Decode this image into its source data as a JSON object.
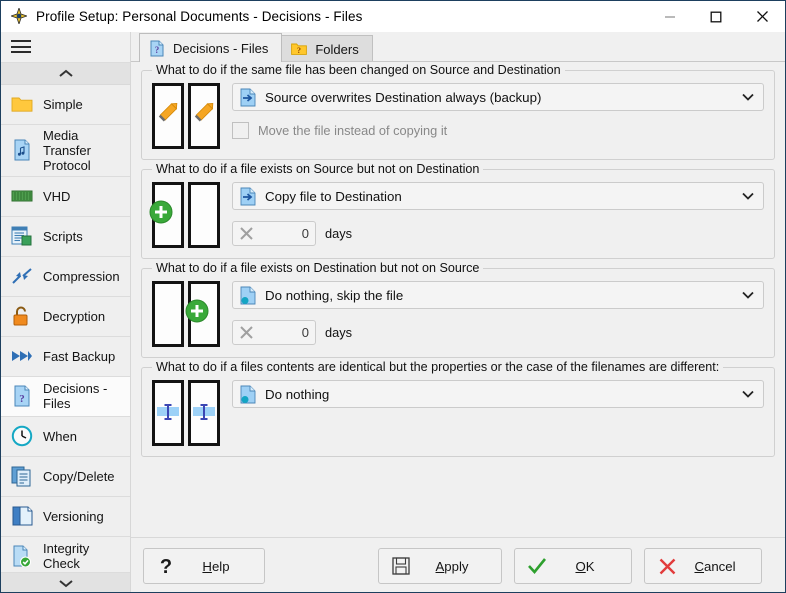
{
  "window": {
    "title": "Profile Setup: Personal Documents - Decisions - Files",
    "app_icon": "compass-icon",
    "minimize_label": "Minimize",
    "maximize_label": "Maximize",
    "close_label": "Close"
  },
  "sidebar": {
    "menu_label": "Menu",
    "scroll_up_label": "Scroll up",
    "scroll_down_label": "Scroll down",
    "items": [
      {
        "label": "Simple",
        "icon": "folder-icon",
        "selected": false
      },
      {
        "label": "Media Transfer\nProtocol",
        "icon": "music-file-icon",
        "selected": false
      },
      {
        "label": "VHD",
        "icon": "drive-icon",
        "selected": false
      },
      {
        "label": "Scripts",
        "icon": "script-icon",
        "selected": false
      },
      {
        "label": "Compression",
        "icon": "compress-arrows-icon",
        "selected": false
      },
      {
        "label": "Decryption",
        "icon": "open-lock-icon",
        "selected": false
      },
      {
        "label": "Fast Backup",
        "icon": "fast-forward-icon",
        "selected": false
      },
      {
        "label": "Decisions -\nFiles",
        "icon": "question-file-icon",
        "selected": true
      },
      {
        "label": "When",
        "icon": "clock-icon",
        "selected": false
      },
      {
        "label": "Copy/Delete",
        "icon": "copy-icon",
        "selected": false
      },
      {
        "label": "Versioning",
        "icon": "versioning-icon",
        "selected": false
      },
      {
        "label": "Integrity Check",
        "icon": "check-file-icon",
        "selected": false
      }
    ]
  },
  "tabs": [
    {
      "label": "Decisions - Files",
      "icon": "question-file-icon",
      "active": true
    },
    {
      "label": "Folders",
      "icon": "question-folder-icon",
      "active": false
    }
  ],
  "groups": [
    {
      "title": "What to do if the same file has been changed on Source and Destination",
      "icon": "two-pages-pencil-pencil-icon",
      "combo": {
        "value": "Source overwrites Destination always (backup)",
        "icon": "blue-arrow-file-icon"
      },
      "checkbox": {
        "label": "Move the file instead of copying it",
        "checked": false,
        "enabled": false
      }
    },
    {
      "title": "What to do if a file exists on Source but not on Destination",
      "icon": "two-pages-plus-left-icon",
      "combo": {
        "value": "Copy file to Destination",
        "icon": "blue-arrow-file-icon"
      },
      "spinner": {
        "value": "0",
        "unit": "days",
        "icon": "grey-x-icon"
      }
    },
    {
      "title": "What to do if a file exists on Destination but not on Source",
      "icon": "two-pages-plus-right-icon",
      "combo": {
        "value": "Do nothing, skip the file",
        "icon": "blue-dot-file-icon"
      },
      "spinner": {
        "value": "0",
        "unit": "days",
        "icon": "grey-x-icon"
      }
    },
    {
      "title": "What to do if a files contents are identical but the properties or the case of the filenames are different:",
      "icon": "two-pages-ibeam-icon",
      "combo": {
        "value": "Do nothing",
        "icon": "blue-dot-file-icon"
      }
    }
  ],
  "footer": {
    "help": {
      "label": "Help",
      "accel": "H",
      "icon": "question-mark-icon"
    },
    "apply": {
      "label": "Apply",
      "accel": "A",
      "icon": "floppy-disk-icon"
    },
    "ok": {
      "label": "OK",
      "accel": "O",
      "icon": "green-check-icon"
    },
    "cancel": {
      "label": "Cancel",
      "accel": "C",
      "icon": "red-x-icon"
    }
  },
  "colors": {
    "window_border": "#1d3f5e",
    "background": "#f0f0f0",
    "accent_blue": "#4ea3e8",
    "green": "#3aa93a",
    "red": "#e04040",
    "orange": "#f5a623",
    "yellow_folder": "#ffc72c"
  }
}
